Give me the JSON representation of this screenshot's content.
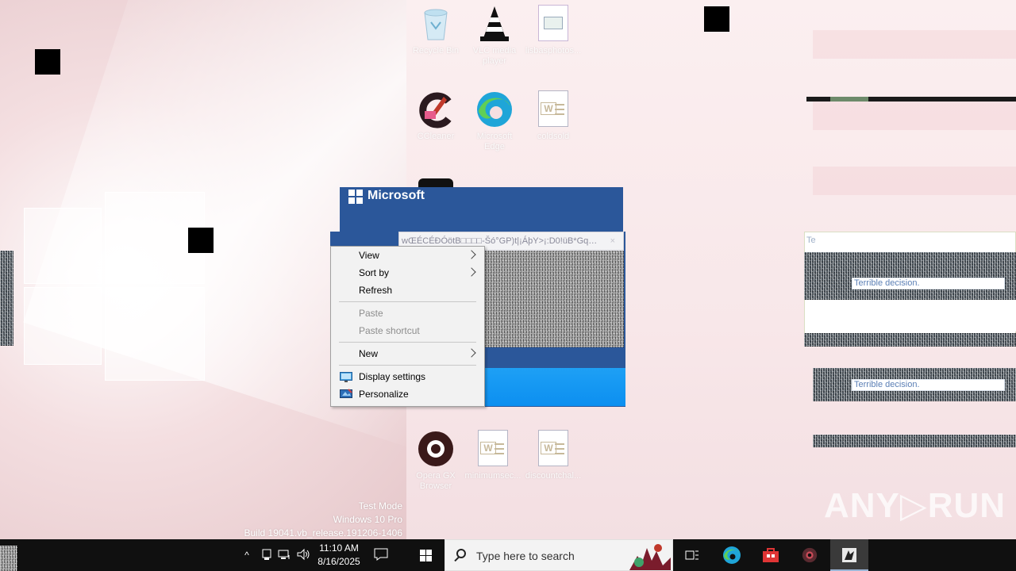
{
  "desktop": {
    "icons": [
      {
        "id": "recycle-bin",
        "label": "Recycle Bin",
        "icon": "recycle-bin-icon"
      },
      {
        "id": "vlc",
        "label": "VLC media player",
        "icon": "vlc-cone-icon"
      },
      {
        "id": "image-doc",
        "label": "lisbasphotos...",
        "icon": "image-file-icon"
      },
      {
        "id": "ccleaner",
        "label": "CCleaner",
        "icon": "ccleaner-icon"
      },
      {
        "id": "edge",
        "label": "Microsoft Edge",
        "icon": "edge-icon"
      },
      {
        "id": "word-doc-1",
        "label": "coldsold",
        "icon": "word-doc-icon"
      },
      {
        "id": "opera-gx",
        "label": "Opera GX Browser",
        "icon": "opera-icon"
      },
      {
        "id": "word-doc-2",
        "label": "minimumsec...",
        "icon": "word-doc-icon"
      },
      {
        "id": "word-doc-3",
        "label": "discountchal...",
        "icon": "word-doc-icon"
      }
    ]
  },
  "installer": {
    "brand": "Microsoft",
    "address_text": "wŒÉCÉÐÓötB□□□□-Šó°GP)t|¡ÁþY>¡:D0!üB*Gq…",
    "close_glyph": "×"
  },
  "context_menu": {
    "items": [
      {
        "label": "View",
        "submenu": true,
        "disabled": false
      },
      {
        "label": "Sort by",
        "submenu": true,
        "disabled": false
      },
      {
        "label": "Refresh",
        "submenu": false,
        "disabled": false
      },
      {
        "label": "Paste",
        "submenu": false,
        "disabled": true
      },
      {
        "label": "Paste shortcut",
        "submenu": false,
        "disabled": true
      },
      {
        "label": "New",
        "submenu": true,
        "disabled": false
      },
      {
        "label": "Display settings",
        "submenu": false,
        "disabled": false,
        "icon": "display-settings-icon"
      },
      {
        "label": "Personalize",
        "submenu": false,
        "disabled": false,
        "icon": "personalize-icon"
      }
    ]
  },
  "right_windows": {
    "tag": "Te",
    "field_1": "Terrible decision.",
    "field_2": "Terrible decision."
  },
  "watermark": {
    "line1": "Test Mode",
    "line2": "Windows 10 Pro",
    "line3": "Build 19041.vb_release.191206-1406",
    "brand": "ANY▷RUN"
  },
  "taskbar": {
    "time": "11:10 AM",
    "date": "8/16/2025",
    "search_placeholder": "Type here to search",
    "tray_chevron": "^",
    "colors": {
      "bg": "#101010",
      "search_bg": "#f3f3f3",
      "accent": "#2b579a"
    }
  }
}
